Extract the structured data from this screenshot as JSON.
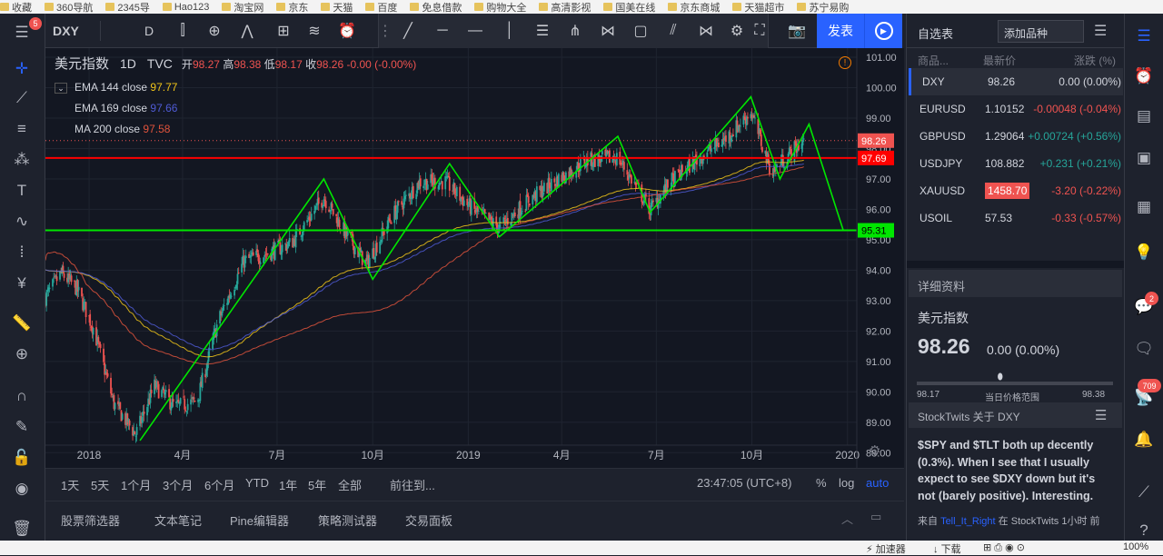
{
  "browser": {
    "bookmarks": [
      "收藏",
      "360导航",
      "2345导",
      "Hao123",
      "淘宝网",
      "京东",
      "天猫",
      "百度",
      "免息借款",
      "购物大全",
      "高清影视",
      "国美在线",
      "京东商城",
      "天猫超市",
      "苏宁易购"
    ]
  },
  "toolbar": {
    "symbol": "DXY",
    "interval": "D",
    "publish_label": "发表",
    "notif_badge": "5"
  },
  "chart": {
    "title": "美元指数",
    "interval": "1D",
    "exchange": "TVC",
    "ohlc": {
      "open_label": "开",
      "open": "98.27",
      "high_label": "高",
      "high": "98.38",
      "low_label": "低",
      "low": "98.17",
      "close_label": "收",
      "close": "98.26",
      "change": "-0.00 (-0.00%)"
    },
    "indicators": [
      {
        "label": "EMA 144 close",
        "value": "97.77",
        "color": "#f0c419"
      },
      {
        "label": "EMA 169 close",
        "value": "97.66",
        "color": "#4f5bd5"
      },
      {
        "label": "MA 200 close",
        "value": "97.58",
        "color": "#e0533c"
      }
    ],
    "price_ticks": [
      "101.00",
      "100.00",
      "99.00",
      "98.00",
      "97.00",
      "96.00",
      "95.00",
      "94.00",
      "93.00",
      "92.00",
      "91.00",
      "90.00",
      "89.00",
      "88.00"
    ],
    "time_ticks": [
      "2018",
      "4月",
      "7月",
      "10月",
      "2019",
      "4月",
      "7月",
      "10月",
      "2020"
    ],
    "price_tags": {
      "last": "98.26",
      "red_line": "97.69",
      "green_line": "95.31"
    }
  },
  "chart_data": {
    "type": "candlestick",
    "ylim": [
      87.5,
      101.3
    ],
    "xlim": [
      "2017-11-20",
      "2020-01-10"
    ],
    "close_path": [
      [
        "2017-11-20",
        93.1
      ],
      [
        "2017-12-05",
        93.9
      ],
      [
        "2017-12-20",
        93.4
      ],
      [
        "2018-01-05",
        92.1
      ],
      [
        "2018-01-25",
        89.6
      ],
      [
        "2018-02-15",
        88.6
      ],
      [
        "2018-03-05",
        90.2
      ],
      [
        "2018-03-25",
        89.5
      ],
      [
        "2018-04-15",
        89.7
      ],
      [
        "2018-05-05",
        92.3
      ],
      [
        "2018-05-30",
        94.3
      ],
      [
        "2018-06-25",
        94.6
      ],
      [
        "2018-07-15",
        94.9
      ],
      [
        "2018-08-15",
        96.4
      ],
      [
        "2018-09-05",
        95.2
      ],
      [
        "2018-09-25",
        94.2
      ],
      [
        "2018-10-20",
        95.8
      ],
      [
        "2018-11-15",
        96.9
      ],
      [
        "2018-12-10",
        96.9
      ],
      [
        "2019-01-05",
        96.0
      ],
      [
        "2019-01-31",
        95.4
      ],
      [
        "2019-02-28",
        96.3
      ],
      [
        "2019-03-25",
        96.9
      ],
      [
        "2019-04-25",
        97.6
      ],
      [
        "2019-05-25",
        97.7
      ],
      [
        "2019-06-25",
        96.0
      ],
      [
        "2019-07-15",
        96.9
      ],
      [
        "2019-08-15",
        97.8
      ],
      [
        "2019-09-05",
        98.3
      ],
      [
        "2019-09-30",
        99.2
      ],
      [
        "2019-10-20",
        97.2
      ],
      [
        "2019-11-05",
        97.8
      ],
      [
        "2019-11-20",
        98.26
      ]
    ]
  },
  "watchlist": {
    "title": "自选表",
    "add_label": "添加品种",
    "headers": [
      "商品...",
      "最新价",
      "涨跌 (%)"
    ],
    "rows": [
      {
        "symbol": "DXY",
        "price": "98.26",
        "change": "0.00 (0.00%)",
        "dir": "flat"
      },
      {
        "symbol": "EURUSD",
        "price": "1.10152",
        "change": "-0.00048 (-0.04%)",
        "dir": "down"
      },
      {
        "symbol": "GBPUSD",
        "price": "1.29064",
        "change": "+0.00724 (+0.56%)",
        "dir": "up"
      },
      {
        "symbol": "USDJPY",
        "price": "108.882",
        "change": "+0.231 (+0.21%)",
        "dir": "up"
      },
      {
        "symbol": "XAUUSD",
        "price": "1458.70",
        "change": "-3.20 (-0.22%)",
        "dir": "down"
      },
      {
        "symbol": "USOIL",
        "price": "57.53",
        "change": "-0.33 (-0.57%)",
        "dir": "down"
      }
    ]
  },
  "details": {
    "title": "详细资料",
    "name": "美元指数",
    "price": "98.26",
    "change": "0.00 (0.00%)",
    "range_low": "98.17",
    "range_label": "当日价格范围",
    "range_high": "98.38"
  },
  "stocktwits": {
    "title": "StockTwits 关于 DXY",
    "text": "$SPY and $TLT both up decently (0.3%). When I see that I usually expect to see $DXY down but it's not (barely positive). Interesting.",
    "from_prefix": "来自",
    "user": "Tell_It_Right",
    "from_suffix": "在 StockTwits 1小时 前"
  },
  "bottombar": {
    "ranges": [
      "1天",
      "5天",
      "1个月",
      "3个月",
      "6个月",
      "YTD",
      "1年",
      "5年",
      "全部"
    ],
    "goto": "前往到...",
    "time": "23:47:05 (UTC+8)",
    "pct": "%",
    "log": "log",
    "auto": "auto"
  },
  "panels": [
    "股票筛选器",
    "文本笔记",
    "Pine编辑器",
    "策略测试器",
    "交易面板"
  ],
  "status": {
    "accelerator": "加速器",
    "download": "下载",
    "zoom": "100%"
  },
  "right_badges": {
    "chat": "2",
    "notif": "709"
  },
  "colors": {
    "up": "#26a69a",
    "down": "#ef5350",
    "accent": "#2962ff",
    "green_line": "#00e600",
    "red_line": "#ff0000"
  }
}
